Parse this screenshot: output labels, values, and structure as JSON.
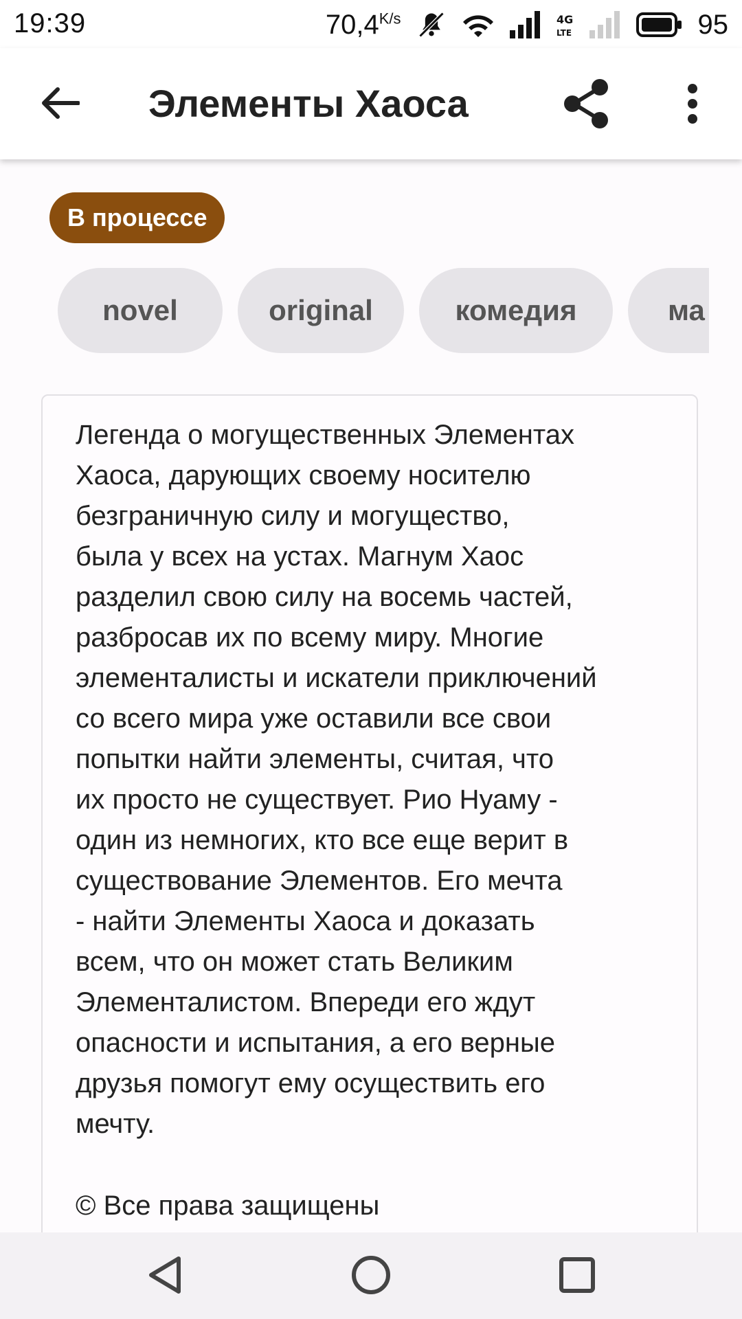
{
  "status_bar": {
    "time": "19:39",
    "net_speed": "70,4",
    "net_speed_unit": "K/s",
    "battery": "95",
    "icons": [
      "mute-icon",
      "wifi-icon",
      "signal-icon",
      "lte-icon",
      "signal-off-icon",
      "battery-icon"
    ]
  },
  "app_bar": {
    "title": "Элементы Хаоса",
    "back_icon": "arrow-left-icon",
    "share_icon": "share-icon",
    "more_icon": "more-vertical-icon"
  },
  "status_chip": {
    "label": "В процессе",
    "color": "#8a4e0e"
  },
  "tags": [
    {
      "label": "novel"
    },
    {
      "label": "original"
    },
    {
      "label": "комедия"
    },
    {
      "label": "ма"
    }
  ],
  "description": {
    "lines": [
      "Легенда о могущественных Элементах",
      "Хаоса, дарующих своему носителю",
      "безграничную силу и могущество,",
      "была у всех на устах. Магнум Хаос",
      "разделил свою силу на восемь частей,",
      "разбросав их по всему миру. Многие",
      "элементалисты и искатели приключений",
      "со всего мира уже оставили все свои",
      "попытки найти элементы, считая, что",
      "их просто не существует. Рио Нуаму -",
      "один из немногих, кто все еще верит в",
      "существование Элементов. Его мечта",
      "- найти Элементы Хаоса и доказать",
      "всем, что он может стать Великим",
      "Элементалистом. Впереди его ждут",
      "опасности и испытания, а его верные",
      "друзья помогут ему осуществить его",
      "мечту."
    ],
    "copyright": "© Все права защищены"
  },
  "nav_bar": {
    "icons": [
      "back-triangle-icon",
      "home-circle-icon",
      "recents-square-icon"
    ]
  }
}
